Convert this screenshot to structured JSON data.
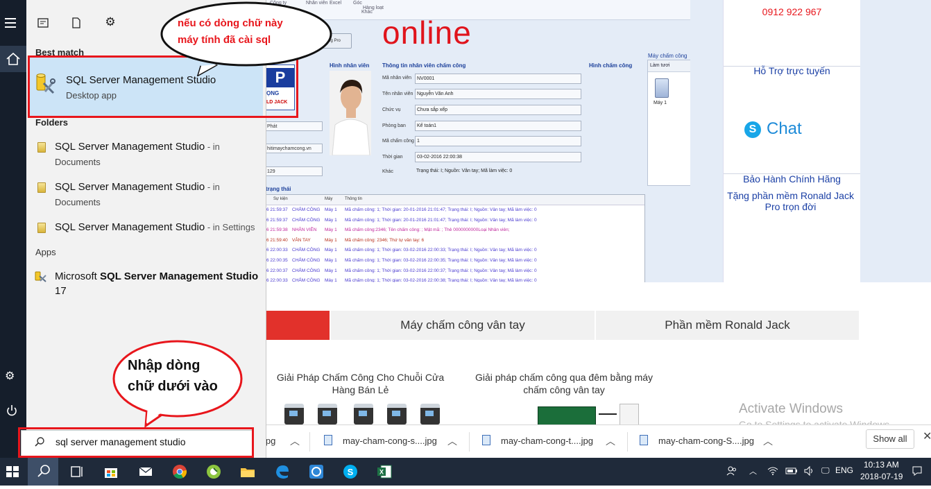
{
  "background_page": {
    "phone": "0912 922 967",
    "software_title": "online",
    "software_button": "Chấm công Pro",
    "toolbar_items": [
      "Công ty",
      "Nhân viên",
      "Excel",
      "Góc",
      "Khác",
      "Hàng loạt"
    ],
    "sections": {
      "employee_photo": "Hình nhân viên",
      "employee_info": "Thông tin nhân viên chấm công",
      "attendance_photo": "Hình chấm công",
      "devices": "Máy chấm công",
      "status": "trạng thái"
    },
    "left_fields": [
      "Phát",
      "hitimaychamcong.vn",
      "129"
    ],
    "employee_fields": [
      {
        "label": "Mã nhân viên",
        "value": "NV0001"
      },
      {
        "label": "Tên nhân viên",
        "value": "Nguyễn Văn Anh"
      },
      {
        "label": "Chức vụ",
        "value": "Chưa sắp xếp"
      },
      {
        "label": "Phòng ban",
        "value": "Kế toán1"
      },
      {
        "label": "Mã chấm công",
        "value": "1"
      },
      {
        "label": "Thời gian",
        "value": "03-02-2016 22:00:38"
      },
      {
        "label": "Khác",
        "value": "Trạng thái: I; Nguồn: Vân tay; Mã làm việc: 0"
      }
    ],
    "devices_refresh": "Làm tươi",
    "device_name": "Máy 1",
    "log_headers": [
      "Sự kiện",
      "Máy",
      "Thông tin"
    ],
    "log_rows": [
      {
        "time": "6 21:59:37",
        "event": "CHẤM CÔNG",
        "machine": "Máy 1",
        "info": "Mã chấm công: 1; Thời gian: 20-01-2016 21:01:47; Trạng thái: I; Nguồn: Vân tay; Mã làm việc: 0",
        "color": "#4a3bd0"
      },
      {
        "time": "6 21:59:37",
        "event": "CHẤM CÔNG",
        "machine": "Máy 1",
        "info": "Mã chấm công: 1; Thời gian: 20-01-2016 21:01:47; Trạng thái: I; Nguồn: Vân tay; Mã làm việc: 0",
        "color": "#4a3bd0"
      },
      {
        "time": "6 21:59:38",
        "event": "NHÂN VIÊN",
        "machine": "Máy 1",
        "info": "Mã chấm công:2346; Tên chấm công: ; Mật mã: ; Thẻ 0000000000Loại Nhân viên;",
        "color": "#c0269c"
      },
      {
        "time": "6 21:59:40",
        "event": "VÂN TAY",
        "machine": "Máy 1",
        "info": "Mã chấm công: 2346; Thứ tự vân tay: 6",
        "color": "#b8301c"
      },
      {
        "time": "6 22:00:33",
        "event": "CHẤM CÔNG",
        "machine": "Máy 1",
        "info": "Mã chấm công: 1; Thời gian: 03-02-2016 22:00:33; Trạng thái: I; Nguồn: Vân tay; Mã làm việc: 0",
        "color": "#4a3bd0"
      },
      {
        "time": "6 22:00:35",
        "event": "CHẤM CÔNG",
        "machine": "Máy 1",
        "info": "Mã chấm công: 1; Thời gian: 03-02-2016 22:00:35; Trạng thái: I; Nguồn: Vân tay; Mã làm việc: 0",
        "color": "#4a3bd0"
      },
      {
        "time": "6 22:00:37",
        "event": "CHẤM CÔNG",
        "machine": "Máy 1",
        "info": "Mã chấm công: 1; Thời gian: 03-02-2016 22:00:37; Trạng thái: I; Nguồn: Vân tay; Mã làm việc: 0",
        "color": "#4a3bd0"
      },
      {
        "time": "6 22:00:33",
        "event": "CHẤM CÔNG",
        "machine": "Máy 1",
        "info": "Mã chấm công: 1; Thời gian: 03-02-2016 22:00:38; Trạng thái: I; Nguồn: Vân tay; Mã làm việc: 0",
        "color": "#4a3bd0"
      }
    ],
    "right_ad": {
      "support": "Hỗ Trợ trực tuyến",
      "chat": "Chat",
      "warranty": "Bảo Hành Chính Hãng",
      "gift": "Tặng phần mềm Ronald Jack Pro trọn đời"
    },
    "tabs": [
      "Máy chấm công vân tay",
      "Phần mềm Ronald Jack"
    ],
    "solutions": [
      "Giải Pháp Chấm Công Cho Chuỗi Cửa Hàng Bán Lẻ",
      "Giải pháp chấm công qua đêm bằng máy chấm công vân tay"
    ],
    "activate_windows": "Activate Windows",
    "activate_sub": "Go to Settings to activate Windows."
  },
  "downloads": {
    "items": [
      "jpg",
      "may-cham-cong-s....jpg",
      "may-cham-cong-t....jpg",
      "may-cham-cong-S....jpg"
    ],
    "show_all": "Show all"
  },
  "start_menu": {
    "best_match_label": "Best match",
    "best_match": {
      "title": "SQL Server Management Studio",
      "subtitle": "Desktop app"
    },
    "folders_label": "Folders",
    "folders": [
      {
        "title": "SQL Server Management Studio",
        "suffix": " - in",
        "location": "Documents"
      },
      {
        "title": "SQL Server Management Studio",
        "suffix": " - in",
        "location": "Documents"
      },
      {
        "title": "SQL Server Management Studio",
        "suffix": " - in Settings",
        "location": ""
      }
    ],
    "apps_label": "Apps",
    "app": {
      "prefix": "Microsoft ",
      "bold": "SQL Server Management Studio",
      "line2": "17"
    },
    "search_query": "sql server management studio"
  },
  "taskbar": {
    "language": "ENG",
    "time": "10:13 AM",
    "date": "2018-07-19"
  },
  "annotations": {
    "bubble_top": [
      "nếu có dòng chữ này",
      "máy tính đã cài sql"
    ],
    "bubble_bottom": [
      "Nhập dòng",
      "chữ dưới vào"
    ]
  },
  "colors": {
    "accent_red": "#e8161c",
    "start_bg": "#f2f2f2",
    "highlight": "#cce4f7",
    "taskbar": "#1f2a3a"
  }
}
